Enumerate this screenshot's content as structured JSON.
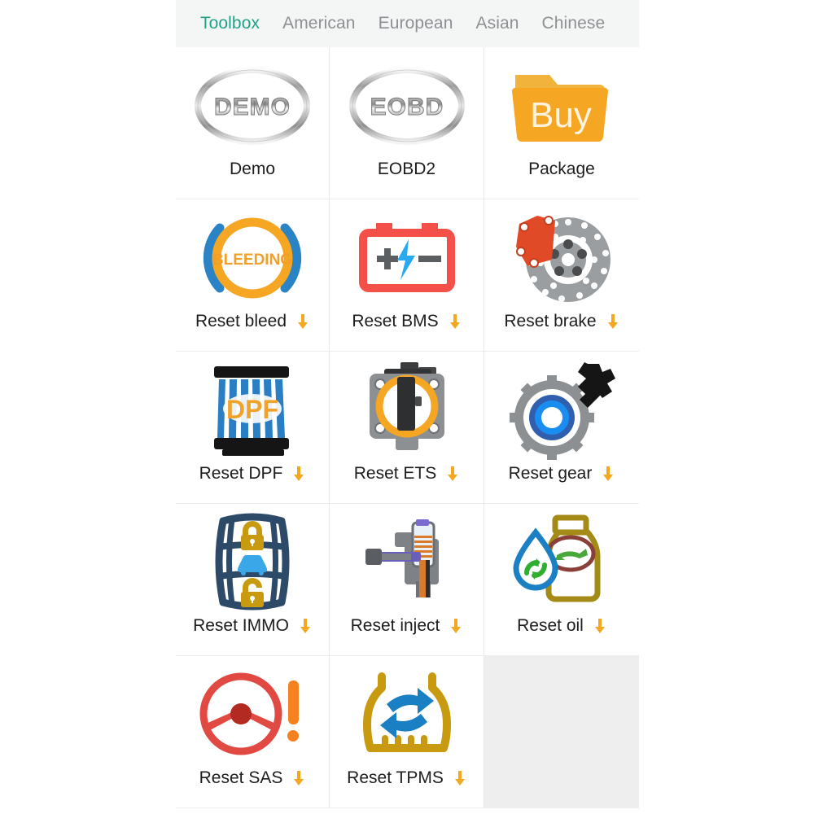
{
  "tabs": [
    {
      "label": "Toolbox",
      "active": true
    },
    {
      "label": "American",
      "active": false
    },
    {
      "label": "European",
      "active": false
    },
    {
      "label": "Asian",
      "active": false
    },
    {
      "label": "Chinese",
      "active": false
    }
  ],
  "colors": {
    "tab_active": "#22a189",
    "tab_inactive": "#8d9094",
    "tabbar_bg": "#f4f5f5",
    "download_arrow": "#f3a81f",
    "grid_line": "#e8e8e8",
    "empty_cell_bg": "#eeeeee",
    "label_text": "#1d1d1d",
    "orange": "#f5a623",
    "blue": "#1b7fc4",
    "red": "#f4504a",
    "gold": "#c79a10",
    "gray": "#8a8d90"
  },
  "tiles": [
    {
      "label": "Demo",
      "icon": "demo-badge-icon",
      "badge_text": "DEMO",
      "download": false
    },
    {
      "label": "EOBD2",
      "icon": "eobd-badge-icon",
      "badge_text": "EOBD",
      "download": false
    },
    {
      "label": "Package",
      "icon": "buy-folder-icon",
      "badge_text": "Buy",
      "download": false
    },
    {
      "label": "Reset bleed",
      "icon": "bleeding-circle-icon",
      "badge_text": "BLEEDING",
      "download": true
    },
    {
      "label": "Reset BMS",
      "icon": "battery-icon",
      "badge_text": "",
      "download": true
    },
    {
      "label": "Reset brake",
      "icon": "brake-disc-caliper-icon",
      "badge_text": "",
      "download": true
    },
    {
      "label": "Reset DPF",
      "icon": "dpf-filter-icon",
      "badge_text": "DPF",
      "download": true
    },
    {
      "label": "Reset ETS",
      "icon": "throttle-body-icon",
      "badge_text": "",
      "download": true
    },
    {
      "label": "Reset gear",
      "icon": "gear-wrench-icon",
      "badge_text": "",
      "download": true
    },
    {
      "label": "Reset IMMO",
      "icon": "key-fob-lock-icon",
      "badge_text": "",
      "download": true
    },
    {
      "label": "Reset inject",
      "icon": "fuel-injector-icon",
      "badge_text": "",
      "download": true
    },
    {
      "label": "Reset oil",
      "icon": "oil-bottle-recycle-icon",
      "badge_text": "",
      "download": true
    },
    {
      "label": "Reset SAS",
      "icon": "steering-wheel-alert-icon",
      "badge_text": "",
      "download": true
    },
    {
      "label": "Reset TPMS",
      "icon": "tpms-tire-icon",
      "badge_text": "",
      "download": true
    },
    {
      "label": "",
      "icon": "empty-placeholder",
      "badge_text": "",
      "download": false
    }
  ]
}
